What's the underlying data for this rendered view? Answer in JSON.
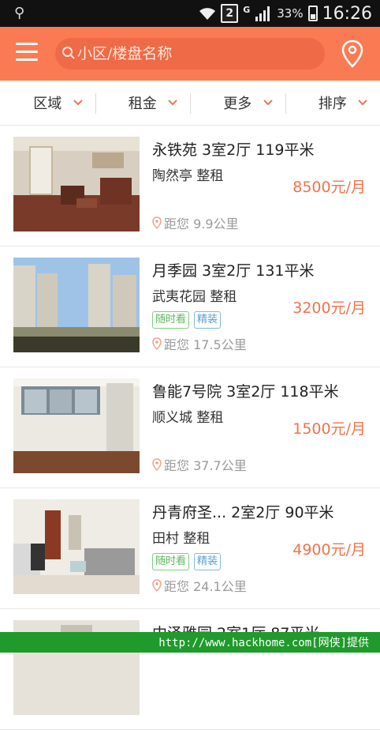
{
  "status_bar": {
    "sim_slot": "2",
    "network_type": "G",
    "battery_percent": "33%",
    "time": "16:26"
  },
  "header": {
    "search_placeholder": "小区/楼盘名称"
  },
  "filters": [
    "区域",
    "租金",
    "更多",
    "排序"
  ],
  "listings": [
    {
      "title": "永铁苑  3室2厅  119平米",
      "area": "陶然亭  整租",
      "price": "8500元/月",
      "tags": [],
      "distance": "距您 9.9公里"
    },
    {
      "title": "月季园  3室2厅  131平米",
      "area": "武夷花园  整租",
      "price": "3200元/月",
      "tags": [
        "随时看",
        "精装"
      ],
      "distance": "距您 17.5公里"
    },
    {
      "title": "鲁能7号院  3室2厅  118平米",
      "area": "顺义城  整租",
      "price": "1500元/月",
      "tags": [],
      "distance": "距您 37.7公里"
    },
    {
      "title": "丹青府圣...  2室2厅  90平米",
      "area": "田村  整租",
      "price": "4900元/月",
      "tags": [
        "随时看",
        "精装"
      ],
      "distance": "距您 24.1公里"
    },
    {
      "title": "中泽雅园  2室1厅  87平米"
    }
  ],
  "watermark": "http://www.hackhome.com[网侠]提供",
  "colors": {
    "header": "#fa7b53",
    "price": "#f0744a",
    "tag_green": "#5cb85c",
    "tag_blue": "#5a9fd4"
  }
}
